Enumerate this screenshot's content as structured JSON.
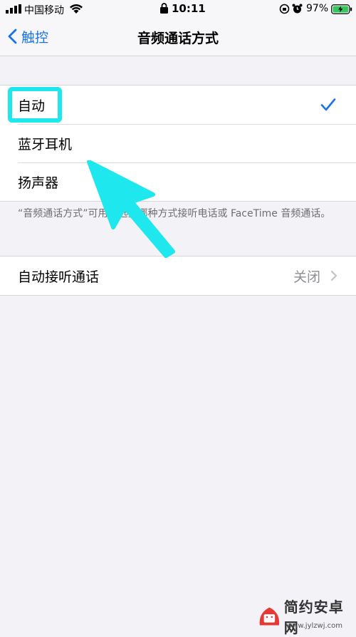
{
  "status_bar": {
    "carrier": "中国移动",
    "time": "10:11",
    "battery_percent": "97%"
  },
  "nav": {
    "back_label": "触控",
    "title": "音频通话方式"
  },
  "audio_routing": {
    "options": [
      {
        "label": "自动",
        "selected": true
      },
      {
        "label": "蓝牙耳机",
        "selected": false
      },
      {
        "label": "扬声器",
        "selected": false
      }
    ],
    "footer": "“音频通话方式”可用于选择哪种方式接听电话或 FaceTime 音频通话。"
  },
  "auto_answer": {
    "label": "自动接听通话",
    "value": "关闭"
  },
  "annotation_colors": {
    "highlight": "#1ee8ee",
    "arrow": "#1ee8ee"
  },
  "watermark": {
    "name": "简约安卓网",
    "url": "www.jylzwj.com"
  }
}
